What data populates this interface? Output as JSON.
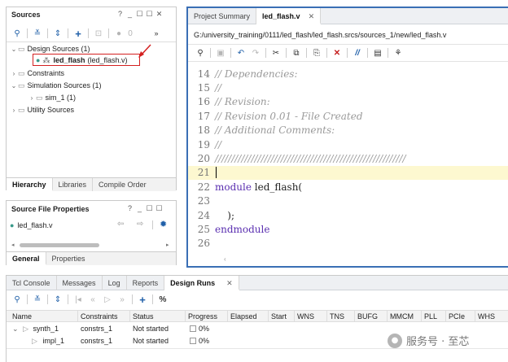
{
  "sources": {
    "title": "Sources",
    "win_controls": [
      "?",
      "_",
      "☐",
      "☐",
      "✕"
    ],
    "toolbar_badge": "0",
    "tree": {
      "design_sources": "Design Sources (1)",
      "top_module": "led_flash",
      "top_file": "(led_flash.v)",
      "constraints": "Constraints",
      "simulation_sources": "Simulation Sources (1)",
      "sim_1": "sim_1 (1)",
      "utility_sources": "Utility Sources"
    },
    "tabs": [
      "Hierarchy",
      "Libraries",
      "Compile Order"
    ],
    "active_tab": "Hierarchy"
  },
  "file_props": {
    "title": "Source File Properties",
    "win_controls": [
      "?",
      "_",
      "☐",
      "☐"
    ],
    "file": "led_flash.v",
    "tabs": [
      "General",
      "Properties"
    ],
    "active_tab": "General"
  },
  "editor": {
    "tabs": [
      "Project Summary",
      "led_flash.v"
    ],
    "active_tab": "led_flash.v",
    "path": "G:/university_training/0111/led_flash/led_flash.srcs/sources_1/new/led_flash.v",
    "lines": [
      {
        "n": "14",
        "text": "// Dependencies:",
        "kind": "comment"
      },
      {
        "n": "15",
        "text": "//",
        "kind": "comment"
      },
      {
        "n": "16",
        "text": "// Revision:",
        "kind": "comment"
      },
      {
        "n": "17",
        "text": "// Revision 0.01 - File Created",
        "kind": "comment"
      },
      {
        "n": "18",
        "text": "// Additional Comments:",
        "kind": "comment"
      },
      {
        "n": "19",
        "text": "//",
        "kind": "comment"
      },
      {
        "n": "20",
        "text": "//////////////////////////////////////////////////////////",
        "kind": "comment"
      },
      {
        "n": "21",
        "text": "",
        "kind": "current"
      },
      {
        "n": "22",
        "text": "module led_flash(",
        "kind": "module"
      },
      {
        "n": "23",
        "text": "",
        "kind": "plain"
      },
      {
        "n": "24",
        "text": "    );",
        "kind": "plain"
      },
      {
        "n": "25",
        "text": "endmodule",
        "kind": "keyword"
      },
      {
        "n": "26",
        "text": "",
        "kind": "plain"
      }
    ]
  },
  "bottom": {
    "tabs": [
      "Tcl Console",
      "Messages",
      "Log",
      "Reports",
      "Design Runs"
    ],
    "active_tab": "Design Runs",
    "columns": [
      "Name",
      "Constraints",
      "Status",
      "Progress",
      "Elapsed",
      "Start",
      "WNS",
      "TNS",
      "BUFG",
      "MMCM",
      "PLL",
      "PCIe",
      "WHS"
    ],
    "rows": [
      {
        "name": "synth_1",
        "constraints": "constrs_1",
        "status": "Not started",
        "progress": "0%"
      },
      {
        "name": "impl_1",
        "constraints": "constrs_1",
        "status": "Not started",
        "progress": "0%"
      }
    ]
  },
  "watermark": "服务号 · 至芯",
  "colors": {
    "accent_blue": "#3a6fb5",
    "highlight_red": "#d42020",
    "current_line": "#fdf8d0"
  }
}
